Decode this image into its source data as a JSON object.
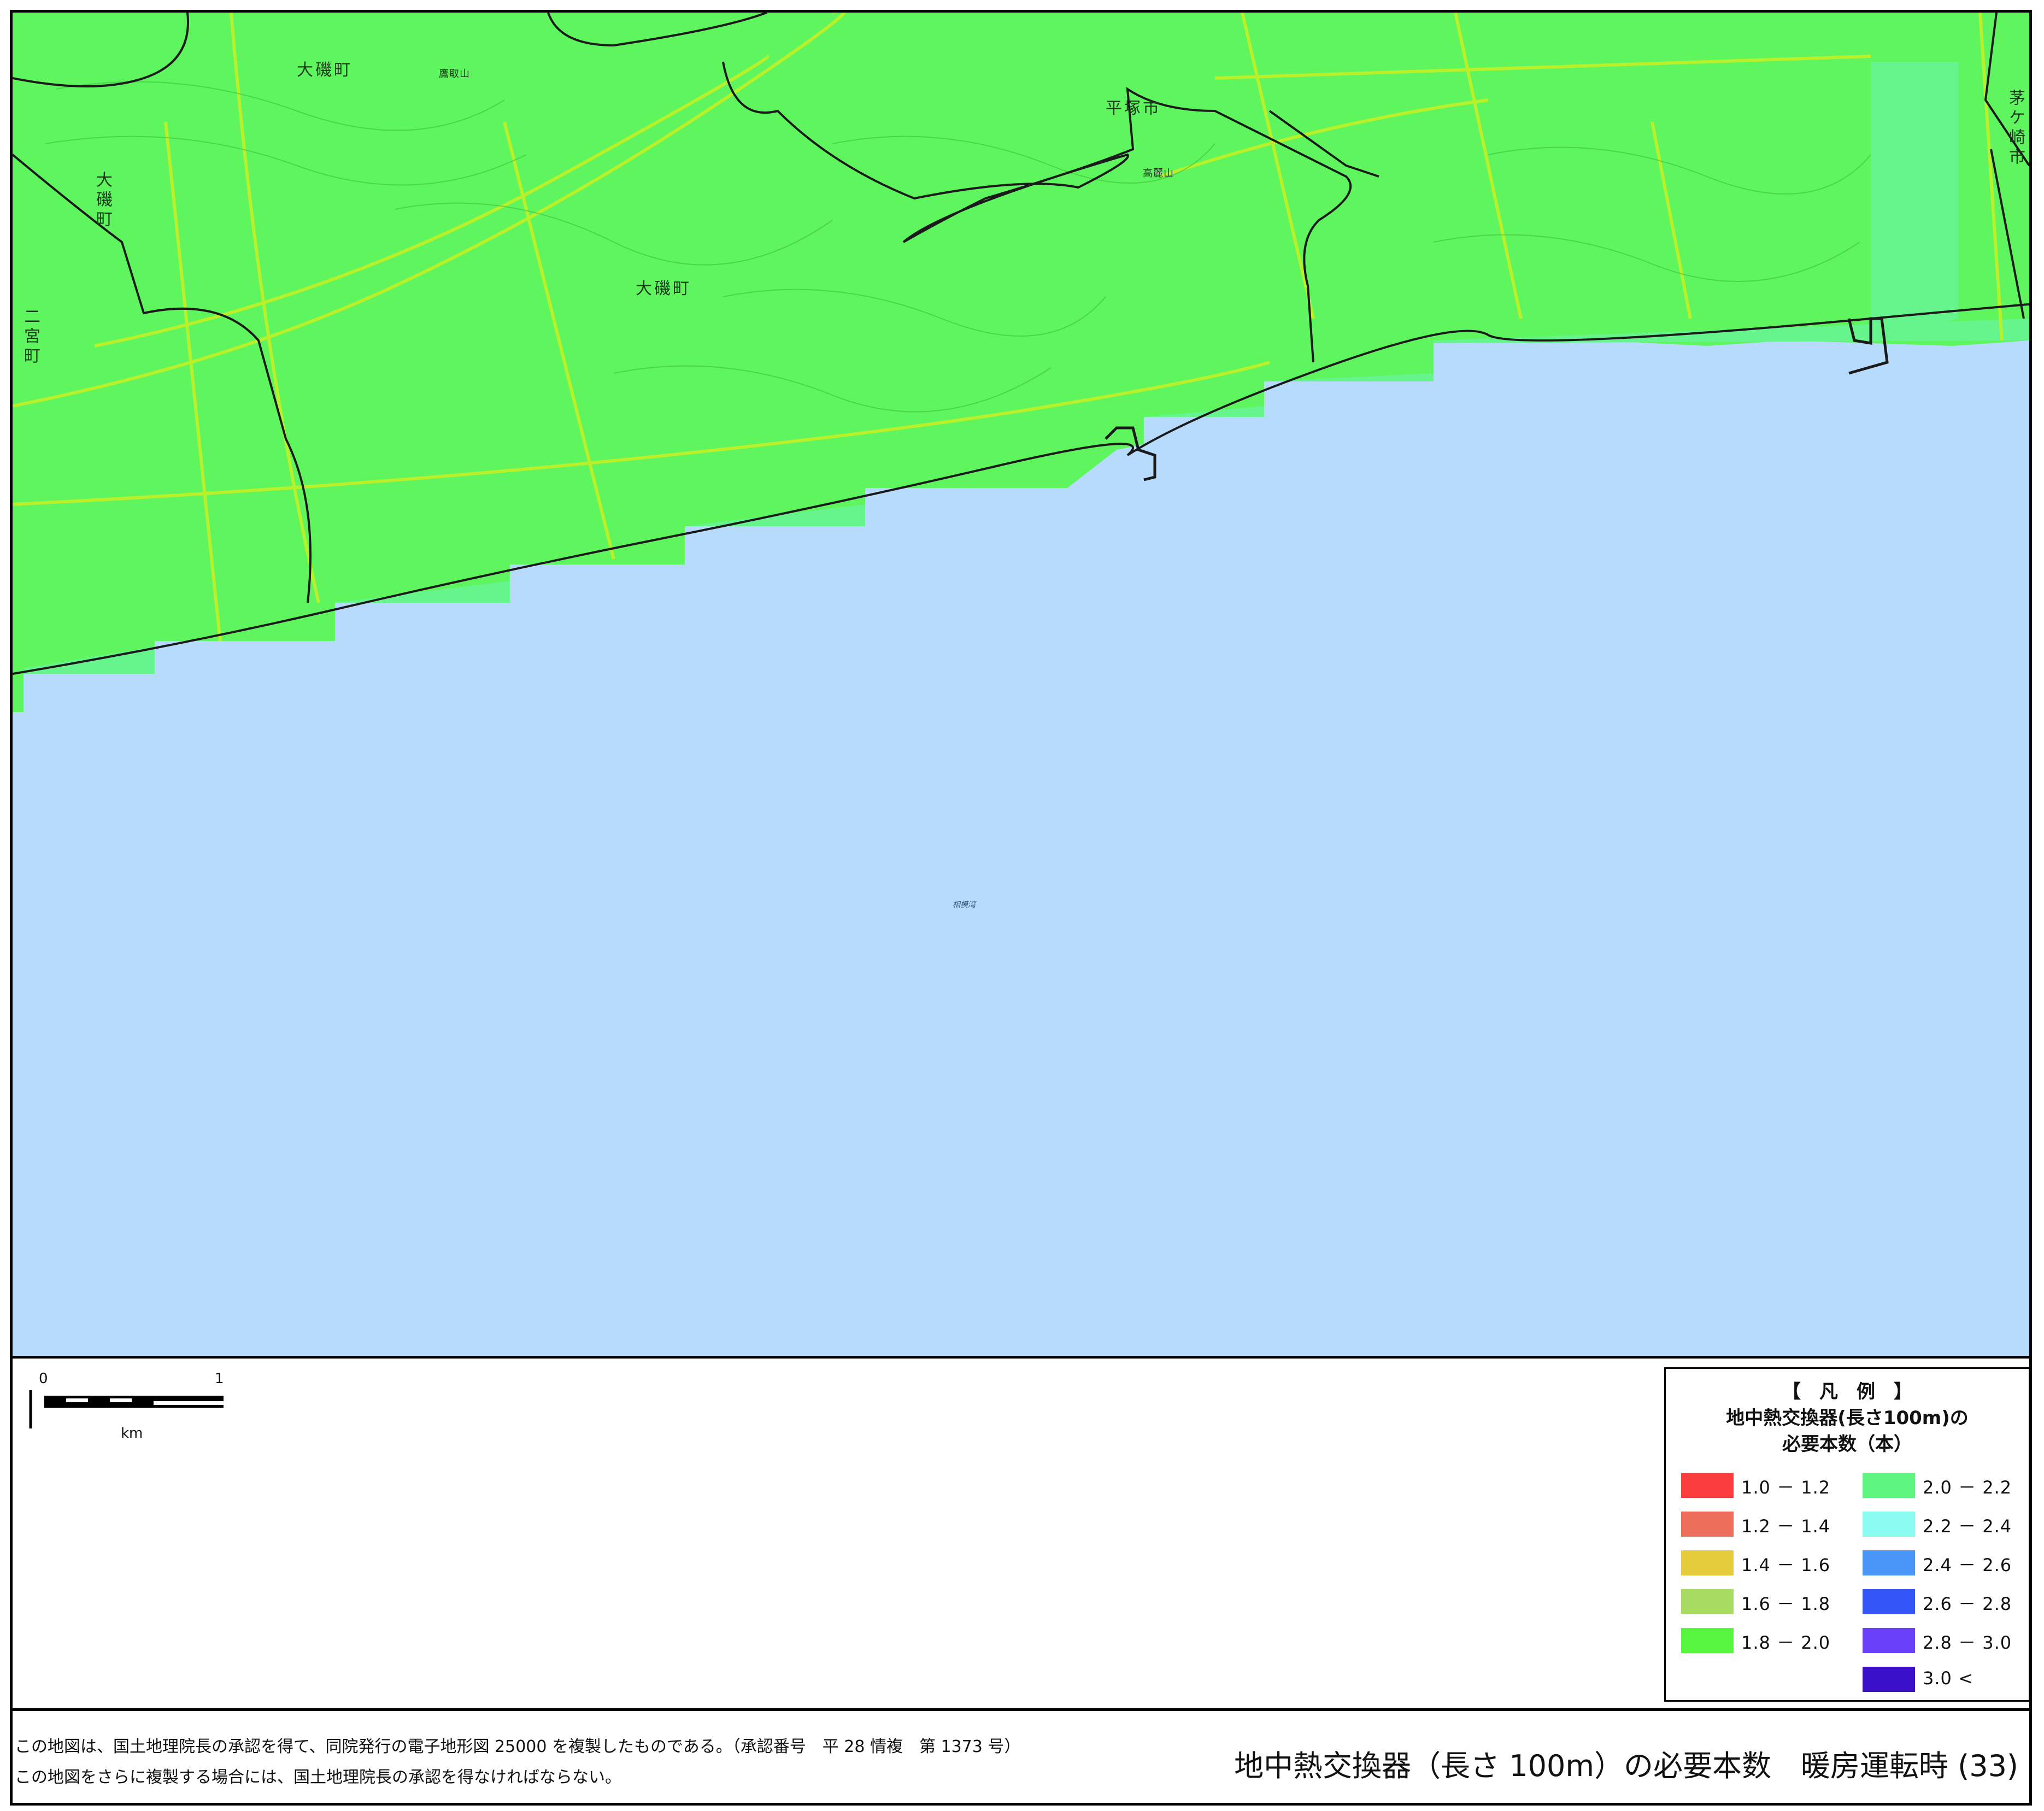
{
  "map": {
    "place_labels": [
      {
        "id": "ooiso-north",
        "text": "大磯町",
        "vertical": false
      },
      {
        "id": "hiratsuka",
        "text": "平塚市",
        "vertical": false
      },
      {
        "id": "ooiso-center",
        "text": "大磯町",
        "vertical": false
      },
      {
        "id": "ooiso-west",
        "text": "大磯町",
        "vertical": true
      },
      {
        "id": "ninomiya",
        "text": "二宮町",
        "vertical": true
      },
      {
        "id": "chigasaki",
        "text": "茅ケ崎市",
        "vertical": true
      }
    ],
    "peak_labels": [
      {
        "id": "takatori",
        "text": "鷹取山"
      },
      {
        "id": "koma",
        "text": "高麗山"
      }
    ],
    "sea_label": "相模湾",
    "colors": {
      "land": "#5ef55e",
      "sea": "#b7dbfd",
      "coast_tint": "#66f58c",
      "boundary": "#1a1a1a",
      "road": "#b8f02a"
    }
  },
  "scale_bar": {
    "start_label": "0",
    "end_label": "1",
    "unit": "km"
  },
  "legend": {
    "heading": "【　凡　例　】",
    "title_line1": "地中熱交換器(長さ100m)の",
    "title_line2": "必要本数（本）",
    "items": [
      {
        "label": "1.0 － 1.2",
        "color": "#fa3e3e"
      },
      {
        "label": "1.2 － 1.4",
        "color": "#ee6e5c"
      },
      {
        "label": "1.4 － 1.6",
        "color": "#e6cd3c"
      },
      {
        "label": "1.6 － 1.8",
        "color": "#a8dc60"
      },
      {
        "label": "1.8 － 2.0",
        "color": "#58f53e"
      },
      {
        "label": "2.0 － 2.2",
        "color": "#5ef580"
      },
      {
        "label": "2.2 － 2.4",
        "color": "#8afcf0"
      },
      {
        "label": "2.4 － 2.6",
        "color": "#4a96f8"
      },
      {
        "label": "2.6 － 2.8",
        "color": "#3456f8"
      },
      {
        "label": "2.8 － 3.0",
        "color": "#6a40f8"
      },
      {
        "label": "3.0 <",
        "color": "#3a10c8"
      }
    ]
  },
  "footer": {
    "note_line1": "この地図は、国土地理院長の承認を得て、同院発行の電子地形図 25000 を複製したものである。（承認番号　平 28 情複　第 1373 号）",
    "note_line2": "この地図をさらに複製する場合には、国土地理院長の承認を得なければならない。",
    "title": "地中熱交換器（長さ 100m）の必要本数　暖房運転時 (33)"
  }
}
